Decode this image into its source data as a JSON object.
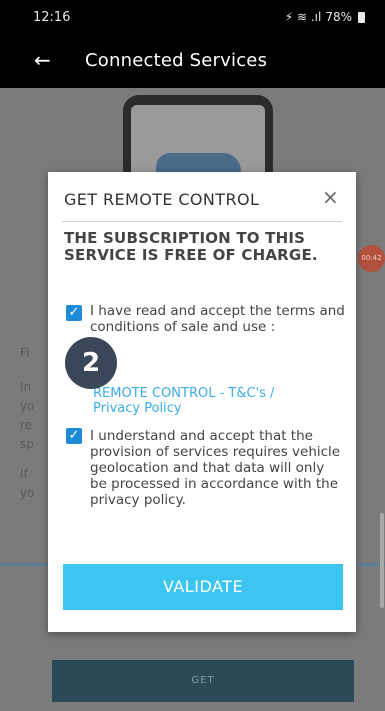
{
  "status_bar": {
    "time": "12:16",
    "indicators": "⚡ ≋ .ıl",
    "battery": "78%"
  },
  "app_bar": {
    "back_glyph": "←",
    "title": "Connected Services"
  },
  "background": {
    "side_letters_1": "Fi",
    "side_letters_2": "In\nyo\nre\nsp",
    "side_letters_3": "If\nyo",
    "side_badge": "00:42",
    "get_button": "GET"
  },
  "modal": {
    "title": "GET REMOTE CONTROL",
    "close_glyph": "×",
    "headline": "THE SUBSCRIPTION TO THIS SERVICE IS FREE OF CHARGE.",
    "terms_text": "I have read and accept the terms and conditions of sale and use :",
    "link_terms": "REMOTE CONTROL - T&C's /",
    "link_privacy": "Privacy Policy",
    "geo_text": "I understand and accept that the provision of services requires vehicle geolocation and that data will only be processed in accordance with the privacy policy.",
    "check_glyph": "✓",
    "validate_label": "VALIDATE"
  },
  "step_badge": "2",
  "colors": {
    "accent_button": "#3cc5f1",
    "checkbox": "#1e8bd6",
    "link": "#3aace6"
  }
}
